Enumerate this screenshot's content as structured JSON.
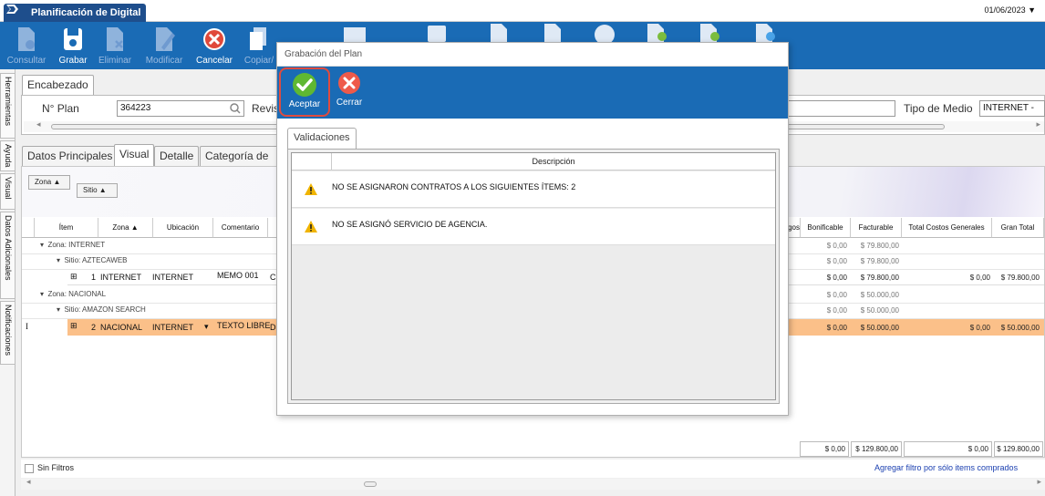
{
  "window": {
    "tab_title": "Planificación de Digital",
    "date": "01/06/2023"
  },
  "toolbar": [
    {
      "label": "Consultar",
      "enabled": false,
      "icon": "search-doc-icon"
    },
    {
      "label": "Grabar",
      "enabled": true,
      "icon": "save-icon"
    },
    {
      "label": "Eliminar",
      "enabled": false,
      "icon": "delete-doc-icon"
    },
    {
      "label": "Modificar",
      "enabled": false,
      "icon": "edit-doc-icon"
    },
    {
      "label": "Cancelar",
      "enabled": true,
      "icon": "cancel-icon"
    },
    {
      "label": "Copiar/",
      "enabled": false,
      "icon": "copy-icon"
    }
  ],
  "side_tabs": [
    "Herramientas",
    "Ayuda",
    "Visual",
    "Datos Adicionales",
    "Notificaciones"
  ],
  "header": {
    "tab": "Encabezado",
    "plan_label": "N° Plan",
    "plan_value": "364223",
    "revision_label": "Revis",
    "media_label": "Tipo de Medio",
    "media_value": "INTERNET - DIGI"
  },
  "tabs": [
    "Datos Principales",
    "Visual",
    "Detalle",
    "Categoría de Íte"
  ],
  "group_chips": {
    "zona": "Zona",
    "sitio": "Sitio"
  },
  "grid": {
    "columns_left": [
      "Ítem",
      "Zona",
      "Ubicación",
      "Comentario"
    ],
    "columns_right": [
      "gos",
      "Bonificable",
      "Facturable",
      "Total Costos Generales",
      "Gran Total"
    ],
    "groups": [
      {
        "zona": "Zona: INTERNET",
        "sitio": "Sitio: AZTECAWEB",
        "bonificable": "$ 0,00",
        "facturable": "$ 79.800,00",
        "sitio_bonificable": "$ 0,00",
        "sitio_facturable": "$ 79.800,00",
        "row": {
          "item": "1",
          "zona": "INTERNET",
          "ubicacion": "INTERNET",
          "comentario": "MEMO 001",
          "extra": "C",
          "bonificable": "$ 0,00",
          "facturable": "$ 79.800,00",
          "total_costos": "$ 0,00",
          "gran_total": "$ 79.800,00"
        }
      },
      {
        "zona": "Zona: NACIONAL",
        "sitio": "Sitio: AMAZON SEARCH",
        "bonificable": "$ 0,00",
        "facturable": "$ 50.000,00",
        "sitio_bonificable": "$ 0,00",
        "sitio_facturable": "$ 50.000,00",
        "row": {
          "item": "2",
          "zona": "NACIONAL",
          "ubicacion": "INTERNET",
          "comentario": "TEXTO LIBRE",
          "extra": "D",
          "bonificable": "$ 0,00",
          "facturable": "$ 50.000,00",
          "total_costos": "$ 0,00",
          "gran_total": "$ 50.000,00"
        }
      }
    ],
    "totals": {
      "bonificable": "$ 0,00",
      "facturable": "$ 129.800,00",
      "total_costos": "$ 0,00",
      "gran_total": "$ 129.800,00"
    },
    "cursor_marker": "I"
  },
  "footer": {
    "filter_label": "Sin Filtros",
    "link": "Agregar filtro por sólo items comprados"
  },
  "dialog": {
    "title": "Grabación del Plan",
    "ok_label": "Aceptar",
    "close_label": "Cerrar",
    "tab": "Validaciones",
    "column": "Descripción",
    "messages": [
      "NO SE ASIGNARON CONTRATOS A LOS SIGUIENTES ÍTEMS: 2",
      "NO SE ASIGNÓ SERVICIO DE AGENCIA."
    ]
  },
  "colors": {
    "brand": "#1a6bb5",
    "title_tab": "#1e4e8c",
    "highlight_row": "#fbc089",
    "link": "#1a3fb0",
    "ok_ring": "#e04b3e"
  }
}
